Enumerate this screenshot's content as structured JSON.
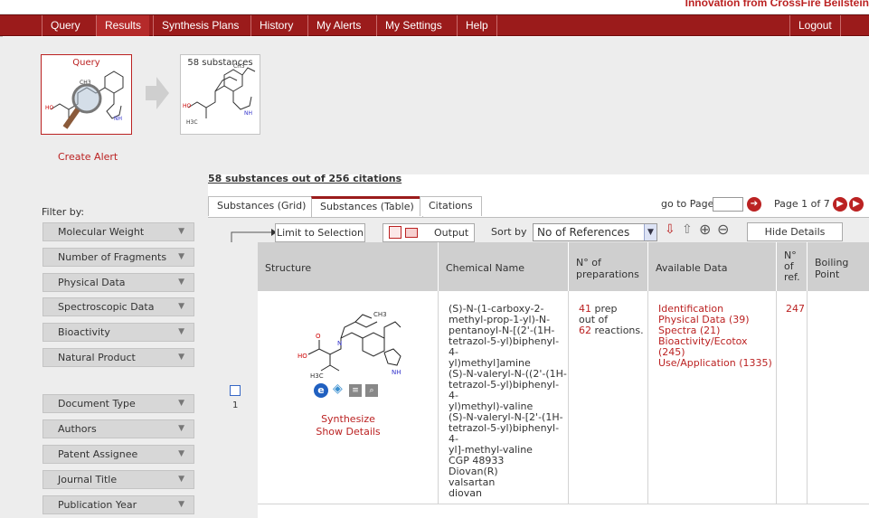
{
  "top": {
    "slogan": "Innovation from CrossFire Beilstein"
  },
  "nav": {
    "items": [
      "Query",
      "Results",
      "Synthesis Plans",
      "History",
      "My Alerts",
      "My Settings",
      "Help"
    ],
    "logout": "Logout"
  },
  "workflow": {
    "query_label": "Query",
    "result_label": "58 substances"
  },
  "create_alert": "Create Alert",
  "filter": {
    "title": "Filter by:",
    "groups": [
      [
        "Molecular Weight",
        "Number of Fragments",
        "Physical Data",
        "Spectroscopic Data",
        "Bioactivity",
        "Natural Product"
      ],
      [
        "Document Type",
        "Authors",
        "Patent Assignee",
        "Journal Title",
        "Publication Year"
      ]
    ]
  },
  "results": {
    "count_title": "58 substances out of 256 citations",
    "tabs": [
      "Substances (Grid)",
      "Substances (Table)",
      "Citations"
    ],
    "active_tab": 1,
    "goto_label": "go to Page",
    "page_label": "Page 1 of 7"
  },
  "toolbar": {
    "limit": "Limit to Selection",
    "output": "Output",
    "sort_by": "Sort by",
    "sort_value": "No of References",
    "hide_details": "Hide Details"
  },
  "table": {
    "headers": [
      "Structure",
      "Chemical Name",
      "N° of preparations",
      "Available Data",
      "N° of ref.",
      "Boiling Point"
    ],
    "rows": [
      {
        "index": "1",
        "synthesize": "Synthesize",
        "show_details": "Show Details",
        "chemical_name": [
          "(S)-N-(1-carboxy-2-",
          "methyl-prop-1-yl)-N-",
          "pentanoyl-N-[(2'-(1H-",
          "tetrazol-5-yl)biphenyl-4-",
          "yl)methyl]amine",
          "(S)-N-valeryl-N-((2'-(1H-",
          "tetrazol-5-yl)biphenyl-4-",
          "yl)methyl)-valine",
          "(S)-N-valeryl-N-[2'-(1H-",
          "tetrazol-5-yl)biphenyl-4-",
          "yl]-methyl-valine",
          "CGP 48933",
          "Diovan(R)",
          "valsartan",
          "diovan"
        ],
        "prep_count": "41",
        "prep_prep": "prep",
        "prep_outof": "out of",
        "prep_reactions_count": "62",
        "prep_reactions": "reactions.",
        "available_data": [
          "Identification",
          "Physical Data (39)",
          "Spectra (21)",
          "Bioactivity/Ecotox (245)",
          "Use/Application (1335)"
        ],
        "refs": "247",
        "boiling": ""
      }
    ]
  },
  "chem_labels": {
    "ch3": "CH3",
    "ho": "HO",
    "h3c": "H3C",
    "nh": "NH",
    "n": "N",
    "o": "O"
  },
  "colors": {
    "nav": "#9b1b1b",
    "accent": "#b22222",
    "panel": "#ededed"
  }
}
